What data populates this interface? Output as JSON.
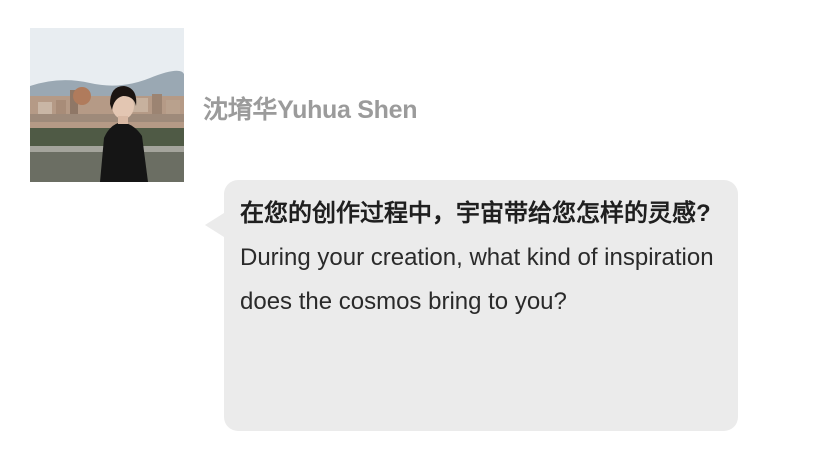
{
  "author": {
    "name": "沈堉华Yuhua Shen",
    "avatar_icon": "portrait-photo"
  },
  "message": {
    "question_zh": "在您的创作过程中，宇宙带给您怎样的灵感?",
    "question_en": "During your creation, what kind of inspiration does the cosmos bring to you?"
  },
  "colors": {
    "bubble_bg": "#ebebeb",
    "name_text": "#9b9b9b",
    "body_text": "#1f1f1f"
  }
}
